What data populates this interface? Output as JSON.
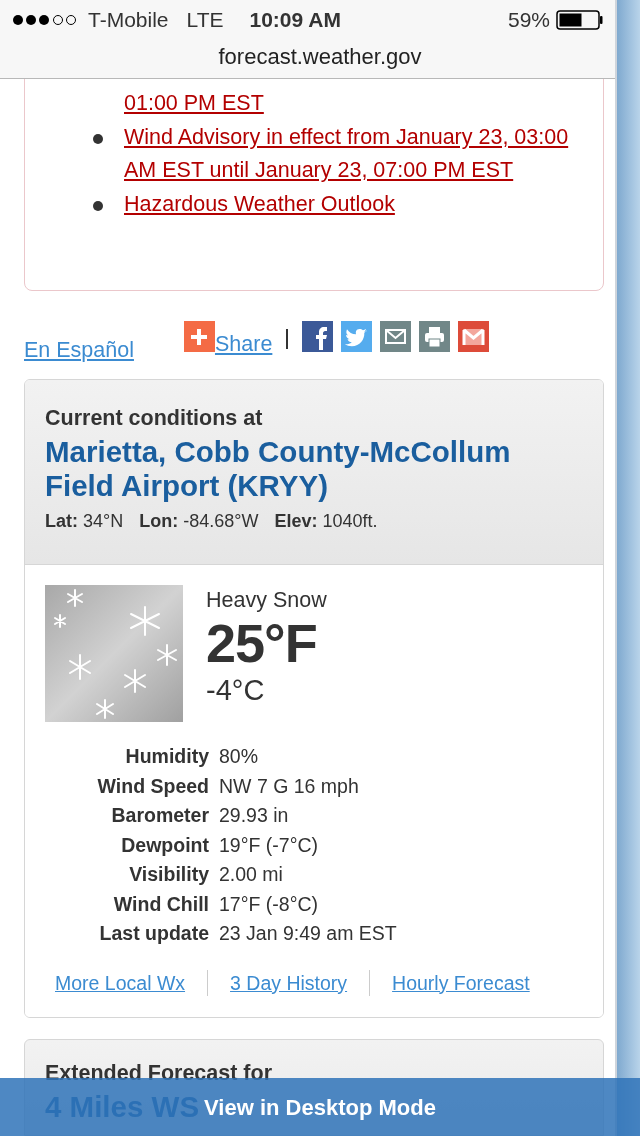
{
  "status_bar": {
    "carrier": "T-Mobile",
    "network": "LTE",
    "time": "10:09 AM",
    "battery": "59%"
  },
  "address_bar": {
    "url": "forecast.weather.gov"
  },
  "alerts": [
    {
      "kind": "continuation",
      "text": "01:00 PM EST"
    },
    {
      "kind": "item",
      "text": "Wind Advisory in effect from January 23, 03:00 AM EST until January 23, 07:00 PM EST"
    },
    {
      "kind": "item",
      "text": "Hazardous Weather Outlook"
    }
  ],
  "language_link": "En Español",
  "share": {
    "label": "Share",
    "buttons": [
      {
        "kind": "facebook",
        "color": "#3b5998"
      },
      {
        "kind": "twitter",
        "color": "#55acee"
      },
      {
        "kind": "email",
        "color": "#718788"
      },
      {
        "kind": "print",
        "color": "#718788"
      },
      {
        "kind": "gmail",
        "color": "#dd4b39"
      }
    ]
  },
  "current_conditions": {
    "heading": "Current conditions at",
    "station": "Marietta, Cobb County-McCollum Field Airport (KRYY)",
    "coords": [
      {
        "label": "Lat:",
        "value": "34°N"
      },
      {
        "label": "Lon:",
        "value": "-84.68°W"
      },
      {
        "label": "Elev:",
        "value": "1040ft."
      }
    ],
    "summary": "Heavy Snow",
    "temp_f": "25°F",
    "temp_c": "-4°C",
    "details": [
      {
        "label": "Humidity",
        "value": "80%"
      },
      {
        "label": "Wind Speed",
        "value": "NW 7 G 16 mph"
      },
      {
        "label": "Barometer",
        "value": "29.93 in"
      },
      {
        "label": "Dewpoint",
        "value": "19°F (-7°C)"
      },
      {
        "label": "Visibility",
        "value": "2.00 mi"
      },
      {
        "label": "Wind Chill",
        "value": "17°F (-8°C)"
      },
      {
        "label": "Last update",
        "value": "23 Jan 9:49 am EST"
      }
    ],
    "links": [
      "More Local Wx",
      "3 Day History",
      "Hourly Forecast"
    ]
  },
  "extended_forecast": {
    "heading": "Extended Forecast for",
    "location": "4 Miles WS"
  },
  "desktop_mode_button": "View in Desktop Mode"
}
